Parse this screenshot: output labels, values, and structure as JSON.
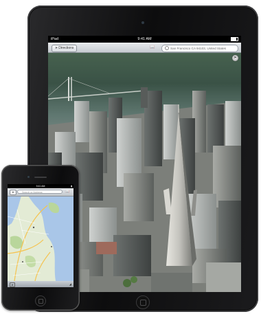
{
  "ipad": {
    "status": {
      "carrier": "iPad",
      "time": "9:41 AM"
    },
    "nav": {
      "directions_label": "Directions",
      "search_value": "San Francisco CA 94103, United States"
    },
    "compass_icon": "compass-icon"
  },
  "iphone": {
    "status": {
      "time": "9:41 AM"
    },
    "nav": {
      "search_placeholder": "Search or Address"
    }
  },
  "colors": {
    "device_black": "#111111",
    "nav_bar": "#d5d9de",
    "sea": "#3f5a4b",
    "map_water": "#a9c6e8",
    "map_land": "#e4ecd6"
  }
}
